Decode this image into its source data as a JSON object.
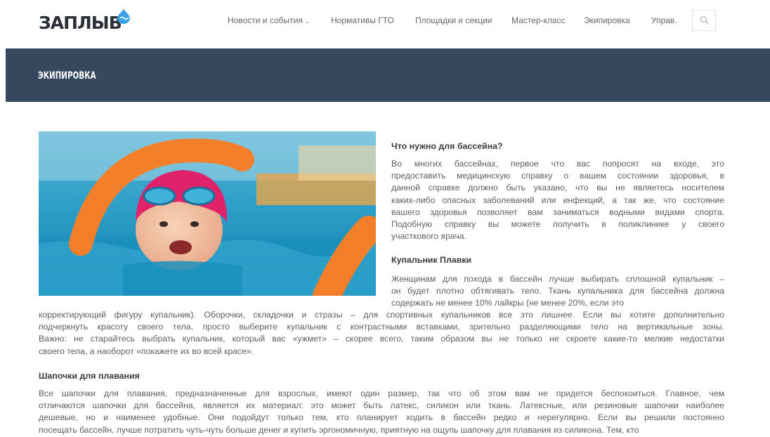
{
  "brand": {
    "logo_text": "ЗАПЛЫВ",
    "accent": "#3aa3e3",
    "header_band": "#36485e"
  },
  "nav": {
    "items": [
      {
        "label": "Новости и события",
        "has_dropdown": true
      },
      {
        "label": "Нормативы ГТО"
      },
      {
        "label": "Площадки и секции"
      },
      {
        "label": "Мастер-класс"
      },
      {
        "label": "Экипировка"
      },
      {
        "label": "Управ."
      }
    ],
    "search_icon": "search-icon"
  },
  "page": {
    "title": "ЭКИПИРОВКА"
  },
  "article": {
    "h1": "Что нужно для бассейна?",
    "p1_lines": [
      "Во многих бассейнах, первое что вас попросят на входе, это",
      "предоставить медицинскую справку о вашем состоянии здоровья, в",
      "данной справке должно быть указано, что вы не являетесь носителем",
      "каких-либо опасных заболеваний или инфекций, а так же, что состояние",
      "вашего здоровья позволяет вам заниматься водными видами спорта.",
      "Подобную справку вы можете получить в поликлинике у своего",
      "участкового врача."
    ],
    "h2": "Купальник Плавки",
    "p2_lines": [
      "Женщинам для похода в бассейн лучше выбирать сплошной купальник –",
      "он будет плотно обтягивать тело. Ткань купальника для бассейна должна",
      "содержать не менее 10% лайкры (не менее 20%, если это",
      "корректирующий фигуру купальник). Оборочки, складочки и стразы – для спортивных купальников все это лишнее. Если вы хотите дополнительно",
      "подчеркнуть красоту своего тела, просто выберите купальник с контрастными вставками, зрительно разделяющими тело на вертикальные зоны.",
      "Важно: не старайтесь выбрать купальник, который вас «ужмет» – скорее всего, таким образом вы не только не скроете какие-то мелкие недостатки",
      "своего тела, а наоборот «покажете их во всей красе»."
    ],
    "h3": "Шапочки для плавания",
    "p3_lines": [
      "Все шапочки для плавания, предназначенные для взрослых, имеют один размер, так что об этом вам не придется беспокоиться. Главное, чем",
      "отличаются шапочки для бассейна, является их материал: это может быть латекс, силикон или ткань. Латексные, или резиновые шапочки наиболее",
      "дешевые, но и наименее удобные. Они подойдут только тем, кто планирует ходить в бассейн редко и нерегулярно. Если вы решили постоянно",
      "посещать бассейн, лучше потратить чуть-чуть больше денег и купить эргономичную, приятную на ощупь шапочку для плавания из силикона. Тем, кто"
    ]
  }
}
